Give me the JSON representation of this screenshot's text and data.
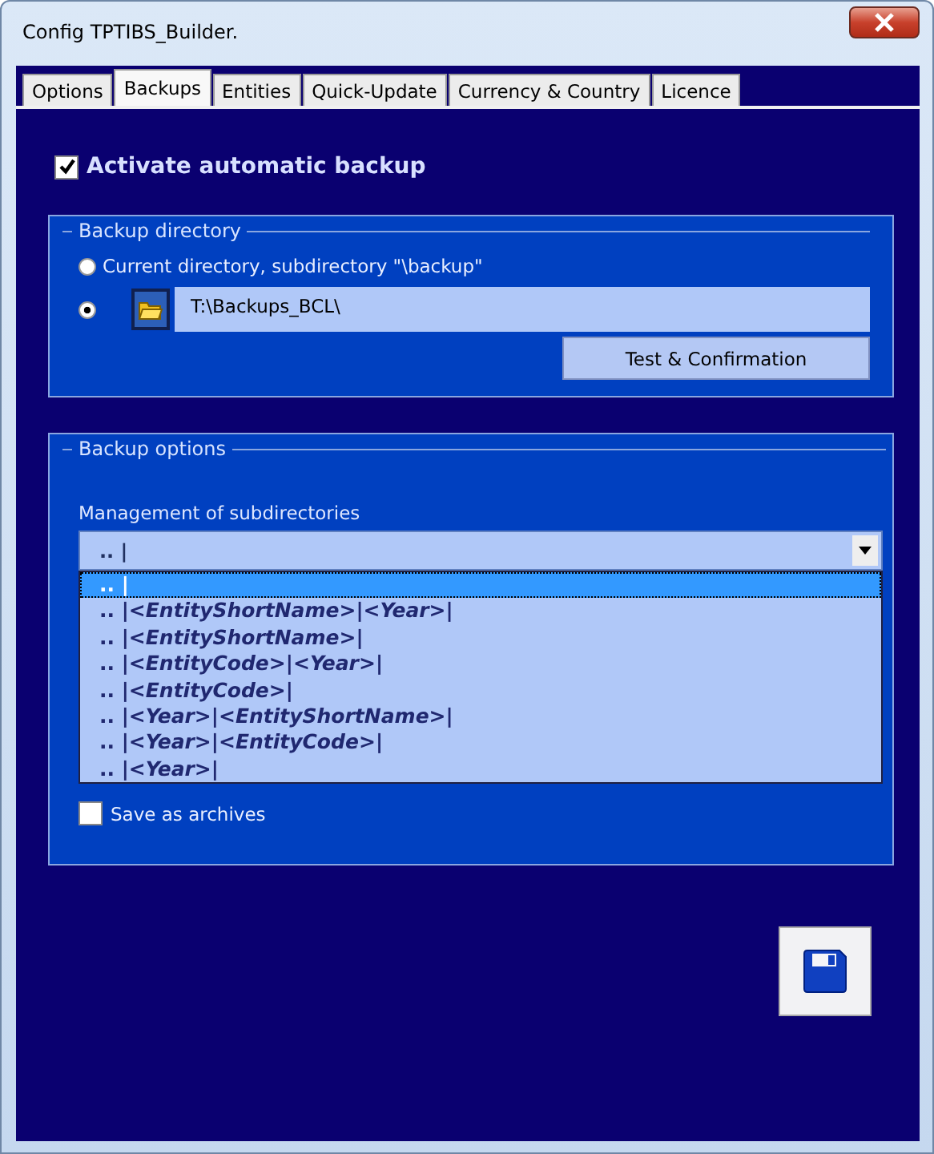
{
  "window": {
    "title": "Config TPTIBS_Builder."
  },
  "tabs": [
    {
      "label": "Options",
      "selected": false
    },
    {
      "label": "Backups",
      "selected": true
    },
    {
      "label": "Entities",
      "selected": false
    },
    {
      "label": "Quick-Update",
      "selected": false
    },
    {
      "label": "Currency & Country",
      "selected": false
    },
    {
      "label": "Licence",
      "selected": false
    }
  ],
  "auto_backup": {
    "label": "Activate automatic backup",
    "checked": true
  },
  "backup_directory": {
    "title": "Backup directory",
    "options": [
      {
        "label": "Current directory, subdirectory \"\\backup\"",
        "selected": false
      },
      {
        "value": "T:\\Backups_BCL\\",
        "selected": true
      }
    ],
    "test_button": "Test & Confirmation"
  },
  "backup_options": {
    "title": "Backup options",
    "subdirectories_label": "Management of subdirectories",
    "subdirectories_value": ".. |",
    "dropdown_items": [
      {
        "text": ".. |",
        "selected": true
      },
      {
        "text": ".. |*<EntityShortName>*|*<Year>*|",
        "selected": false
      },
      {
        "text": ".. |*<EntityShortName>*|",
        "selected": false
      },
      {
        "text": ".. |*<EntityCode>*|*<Year>*|",
        "selected": false
      },
      {
        "text": ".. |*<EntityCode>*|",
        "selected": false
      },
      {
        "text": ".. |*<Year>*|*<EntityShortName>*|",
        "selected": false
      },
      {
        "text": ".. |*<Year>*|*<EntityCode>*|",
        "selected": false
      },
      {
        "text": ".. |*<Year>*|",
        "selected": false
      }
    ],
    "archives": {
      "label": "Save as archives",
      "checked": false
    }
  }
}
